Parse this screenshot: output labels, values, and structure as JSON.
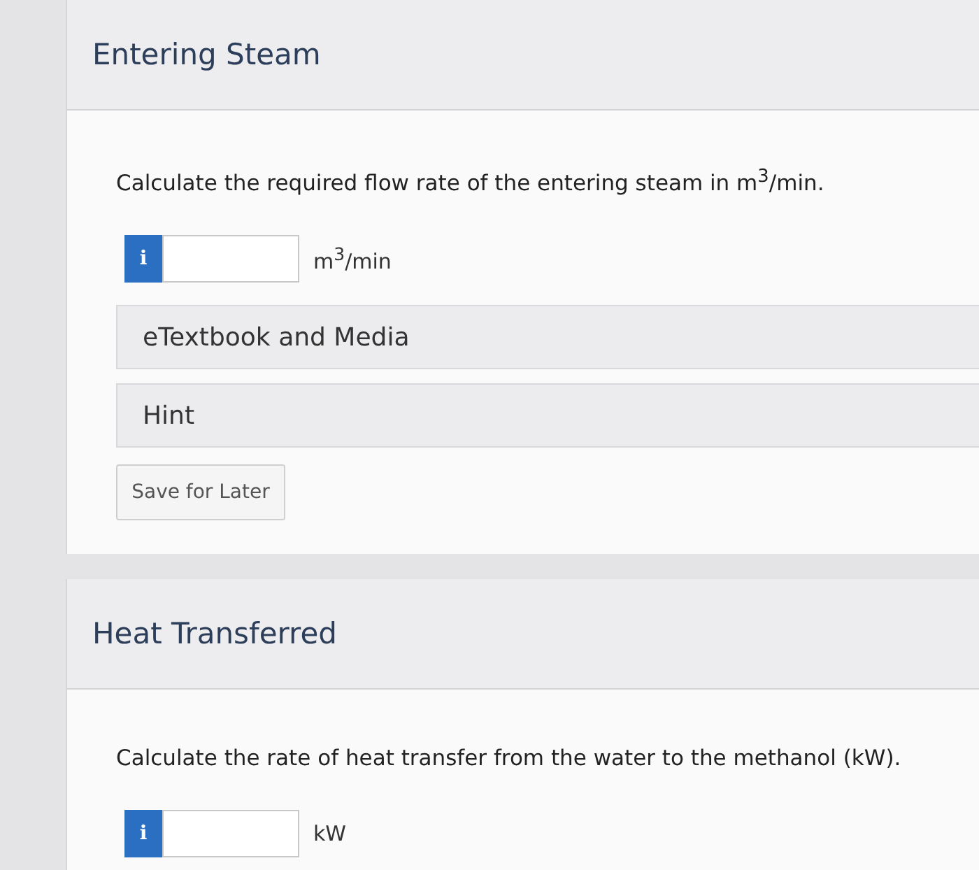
{
  "parts": [
    {
      "title": "Entering Steam",
      "question": "Calculate the required flow rate of the entering steam in m$^{3}$/min.",
      "info_icon": "i",
      "unit": "m$^{3}$/min",
      "resources": [
        "eTextbook and Media",
        "Hint"
      ],
      "save_button": "Save for Later"
    },
    {
      "title": "Heat Transferred",
      "question": "Calculate the rate of heat transfer from the water to the methanol (kW).",
      "info_icon": "i",
      "unit": "kW"
    }
  ]
}
